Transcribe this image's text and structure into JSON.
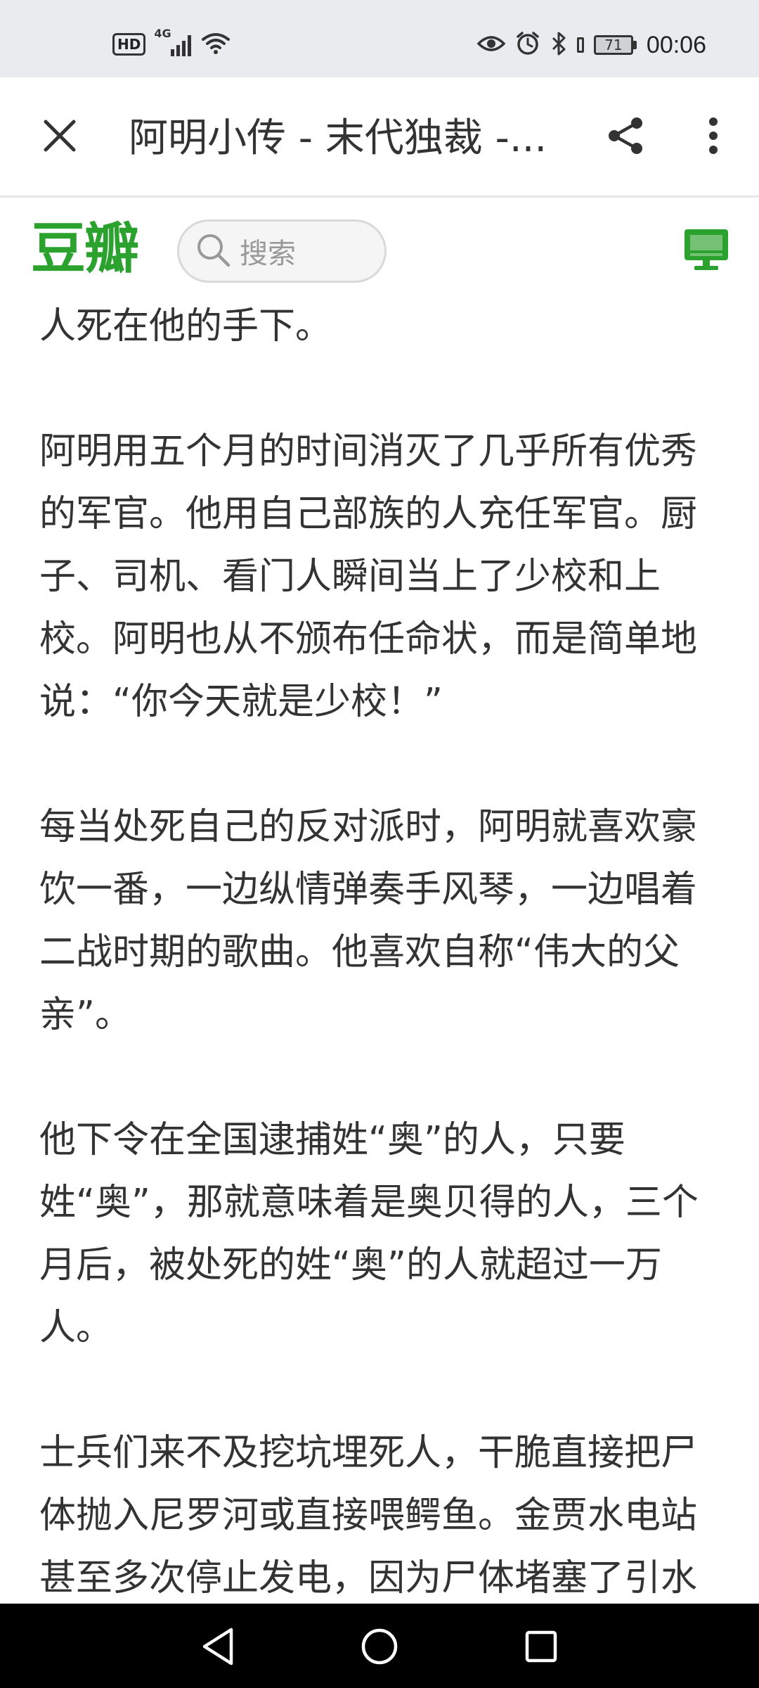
{
  "status_bar": {
    "hd_label": "HD",
    "network_label": "4G",
    "battery_level": "71",
    "time": "00:06"
  },
  "title_bar": {
    "title": "阿明小传 - 末代独裁 -..."
  },
  "site_header": {
    "logo_text": "豆瓣",
    "search_placeholder": "搜索",
    "brand_color": "#2ba12e"
  },
  "article": {
    "paragraphs": [
      "人死在他的手下。",
      "阿明用五个月的时间消灭了几乎所有优秀的军官。他用自己部族的人充任军官。厨子、司机、看门人瞬间当上了少校和上校。阿明也从不颁布任命状，而是简单地说：“你今天就是少校！”",
      "每当处死自己的反对派时，阿明就喜欢豪饮一番，一边纵情弹奏手风琴，一边唱着二战时期的歌曲。他喜欢自称“伟大的父亲”。",
      "他下令在全国逮捕姓“奥”的人，只要姓“奥”，那就意味着是奥贝得的人，三个月后，被处死的姓“奥”的人就超过一万人。",
      "士兵们来不及挖坑埋死人，干脆直接把尸体抛入尼罗河或直接喂鳄鱼。金贾水电站甚至多次停止发电，因为尸体堵塞了引水管道。阿明甚至用死人的尸体做生意，他"
    ]
  },
  "icons": {
    "close": "close-icon",
    "share": "share-icon",
    "more": "more-vertical-icon",
    "search": "search-icon",
    "desktop": "desktop-icon",
    "back": "nav-back-icon",
    "home": "nav-home-icon",
    "recents": "nav-recents-icon"
  }
}
